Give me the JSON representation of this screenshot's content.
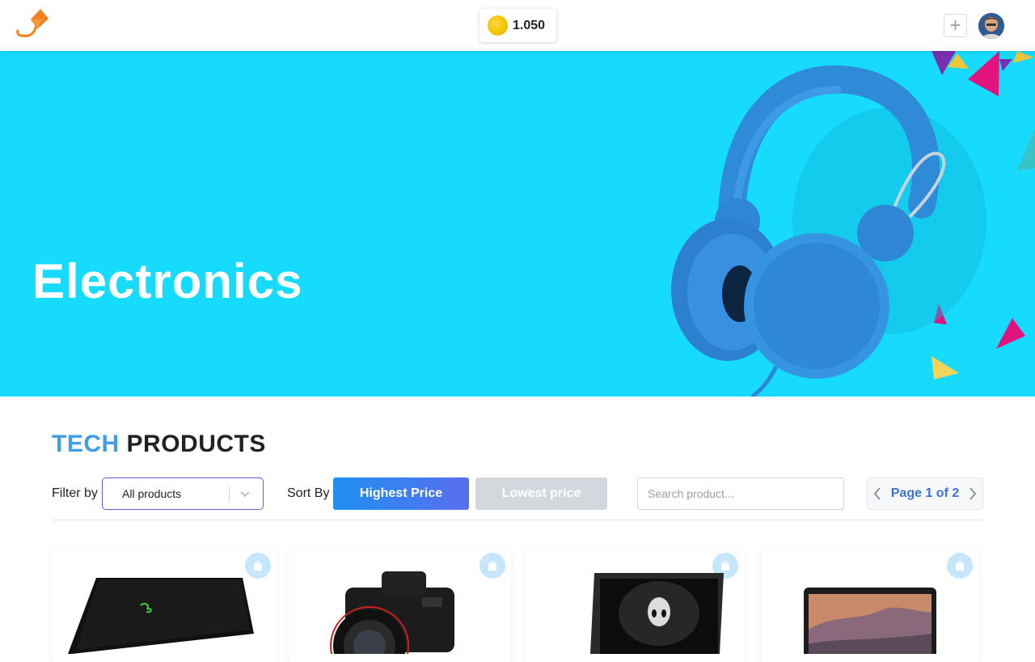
{
  "header": {
    "coins": "1.050",
    "add_label": "+"
  },
  "hero": {
    "title": "Electronics",
    "background_color": "#16dbfd"
  },
  "section": {
    "title_accent": "TECH",
    "title_main": "PRODUCTS"
  },
  "toolbar": {
    "filter_label": "Filter by",
    "filter_value": "All products",
    "sort_label": "Sort By",
    "sort_options": [
      "Highest Price",
      "Lowest price"
    ],
    "search_placeholder": "Search product...",
    "page_text": "Page 1 of 2"
  },
  "products": [
    {
      "name": "laptop-razer",
      "icon": "shopping-bag-icon"
    },
    {
      "name": "camera-canon",
      "icon": "shopping-bag-icon"
    },
    {
      "name": "laptop-alienware",
      "icon": "shopping-bag-icon"
    },
    {
      "name": "laptop-macbook",
      "icon": "shopping-bag-icon"
    }
  ],
  "colors": {
    "accent_blue": "#3f9ee8",
    "sort_active": "#1e90f0",
    "sort_inactive": "#d4d7dc",
    "pager_text": "#3f72d9"
  }
}
